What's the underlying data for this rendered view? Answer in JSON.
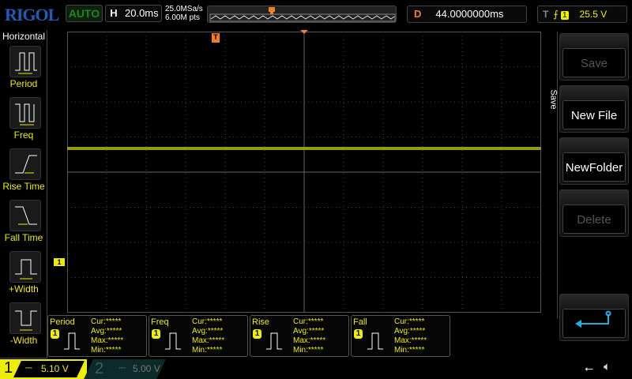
{
  "brand": "RIGOL",
  "status": {
    "run_mode": "AUTO"
  },
  "horizontal": {
    "label": "H",
    "timebase": "20.0ms",
    "sample_rate": "25.0MSa/s",
    "memory_depth": "6.00M pts"
  },
  "delay": {
    "label": "D",
    "value": "44.0000000ms"
  },
  "trigger": {
    "label": "T",
    "edge": "rising",
    "source": "1",
    "level": "25.5 V"
  },
  "left_menu": {
    "title": "Horizontal",
    "items": [
      {
        "label": "Period"
      },
      {
        "label": "Freq"
      },
      {
        "label": "Rise Time"
      },
      {
        "label": "Fall Time"
      },
      {
        "label": "+Width"
      },
      {
        "label": "-Width"
      }
    ]
  },
  "right_menu": {
    "title": "Save",
    "buttons": [
      {
        "label": "Save",
        "enabled": false
      },
      {
        "label": "New File",
        "enabled": true
      },
      {
        "label": "NewFolder",
        "enabled": true
      },
      {
        "label": "Delete",
        "enabled": false
      },
      {
        "label": "",
        "icon": "return-icon"
      }
    ]
  },
  "measurements": [
    {
      "name": "Period",
      "source": "1",
      "cur": "Cur:*****",
      "avg": "Avg:*****",
      "max": "Max:*****",
      "min": "Min:*****"
    },
    {
      "name": "Freq",
      "source": "1",
      "cur": "Cur:*****",
      "avg": "Avg:*****",
      "max": "Max:*****",
      "min": "Min:*****"
    },
    {
      "name": "Rise",
      "source": "1",
      "cur": "Cur:*****",
      "avg": "Avg:*****",
      "max": "Max:*****",
      "min": "Min:*****"
    },
    {
      "name": "Fall",
      "source": "1",
      "cur": "Cur:*****",
      "avg": "Avg:*****",
      "max": "Max:*****",
      "min": "Min:*****"
    }
  ],
  "channels": [
    {
      "num": "1",
      "scale": "5.10 V",
      "coupling": "DC",
      "color": "#eeee00"
    },
    {
      "num": "2",
      "scale": "5.00 V",
      "coupling": "DC",
      "color": "#1a4a4a"
    }
  ],
  "colors": {
    "ch1": "#eeee00",
    "trace": "#9a9a10",
    "trigger_marker": "#f08020",
    "accent": "#1d5fb4",
    "return": "#1cb0e0"
  }
}
